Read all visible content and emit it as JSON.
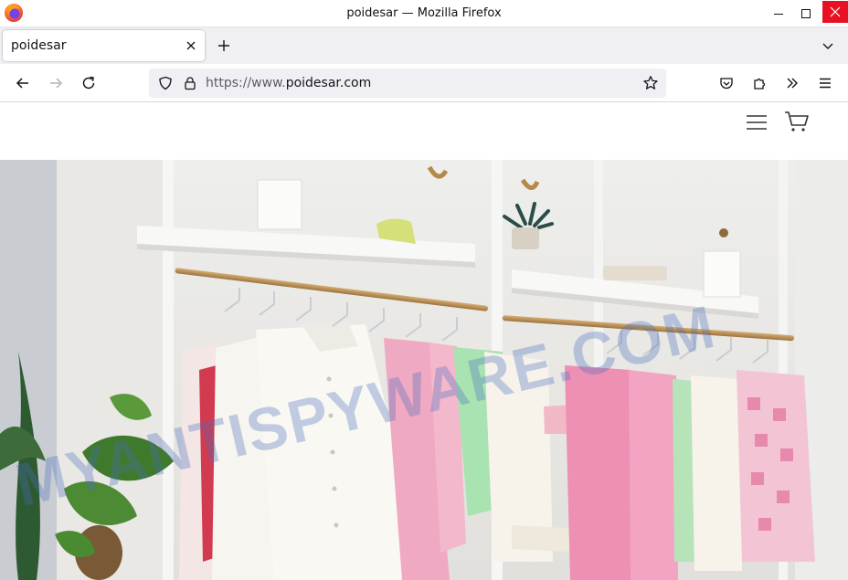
{
  "window": {
    "title": "poidesar — Mozilla Firefox"
  },
  "tabs": [
    {
      "title": "poidesar",
      "active": true
    }
  ],
  "navbar": {
    "url_scheme": "https://www.",
    "url_host": "poidesar.com"
  },
  "site": {
    "menu_icon": "hamburger-menu-icon",
    "cart_icon": "shopping-cart-icon"
  },
  "watermark": {
    "text": "MYANTISPYWARE.COM"
  },
  "colors": {
    "close_button": "#e81123",
    "tabstrip_bg": "#f0f0f4",
    "urlbar_bg": "#f0f0f4",
    "watermark": "#466ebe"
  }
}
